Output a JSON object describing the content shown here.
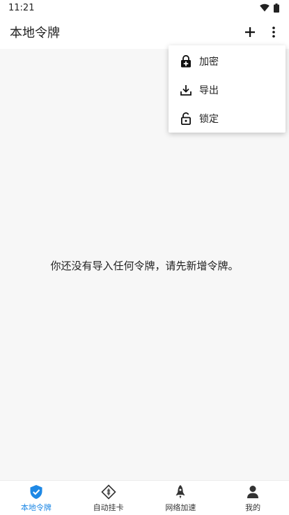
{
  "status_bar": {
    "time": "11:21"
  },
  "app_bar": {
    "title": "本地令牌"
  },
  "menu": {
    "items": [
      {
        "label": "加密",
        "icon": "lock-plus-icon"
      },
      {
        "label": "导出",
        "icon": "download-icon"
      },
      {
        "label": "锁定",
        "icon": "lock-open-icon"
      }
    ]
  },
  "content": {
    "empty_message": "你还没有导入任何令牌，请先新增令牌。"
  },
  "bottom_nav": {
    "items": [
      {
        "label": "本地令牌",
        "icon": "shield-check-icon",
        "active": true
      },
      {
        "label": "自动挂卡",
        "icon": "diamond-icon",
        "active": false
      },
      {
        "label": "网络加速",
        "icon": "rocket-icon",
        "active": false
      },
      {
        "label": "我的",
        "icon": "person-icon",
        "active": false
      }
    ]
  },
  "colors": {
    "accent": "#1e88e5",
    "background": "#f7f7f7",
    "surface": "#ffffff"
  }
}
